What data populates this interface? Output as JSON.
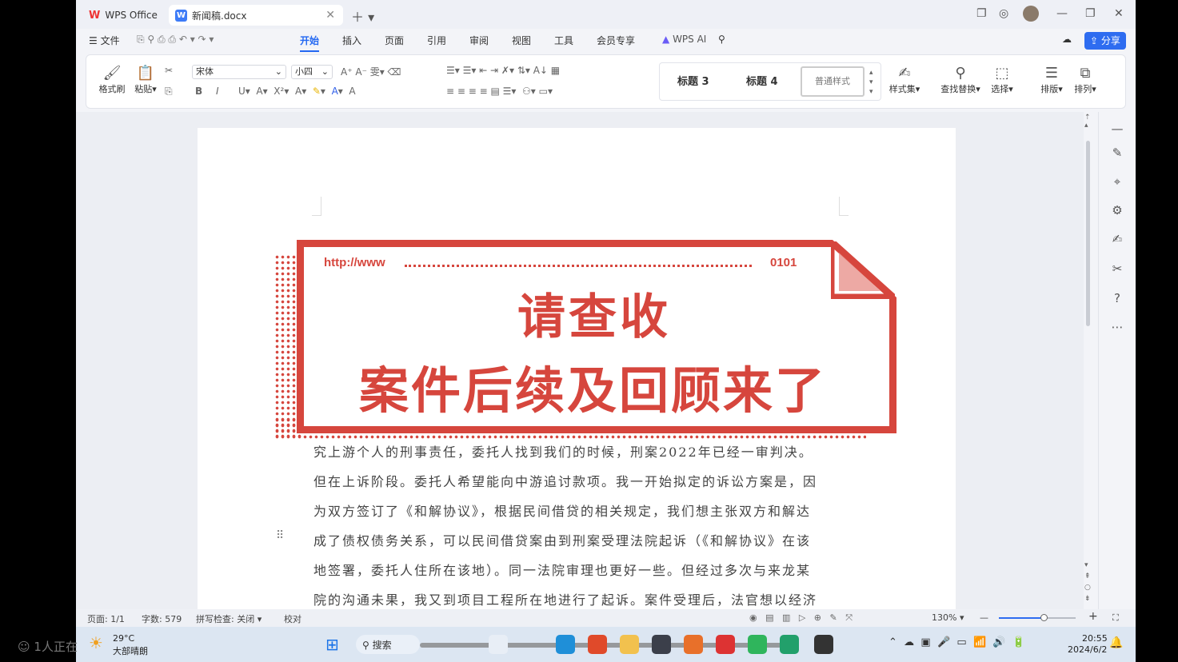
{
  "tabs": [
    {
      "label": "WPS Office"
    },
    {
      "label": "新闻稿.docx"
    }
  ],
  "menu": {
    "file": "文件",
    "items": [
      "开始",
      "插入",
      "页面",
      "引用",
      "审阅",
      "视图",
      "工具",
      "会员专享"
    ],
    "ai": "WPS AI",
    "share": "分享"
  },
  "ribbon": {
    "format_painter": "格式刷",
    "paste": "粘贴",
    "font": "宋体",
    "size": "小四",
    "styles": [
      "标题 3",
      "标题 4",
      "普通样式"
    ],
    "style_set": "样式集",
    "find_replace": "查找替换",
    "select": "选择",
    "layout": "排版",
    "arrange": "排列"
  },
  "banner": {
    "url": "http://www",
    "code": "0101",
    "line1": "请查收",
    "line2": "案件后续及回顾来了"
  },
  "body_lines": [
    "究上游个人的刑事责任，委托人找到我们的时候，刑案2022年已经一审判决。",
    "但在上诉阶段。委托人希望能向中游追讨款项。我一开始拟定的诉讼方案是，因",
    "为双方签订了《和解协议》，根据民间借贷的相关规定，我们想主张双方和解达",
    "成了债权债务关系，可以民间借贷案由到刑案受理法院起诉（《和解协议》在该",
    "地签署，委托人住所在该地）。同一法院审理也更好一些。但经过多次与来龙某",
    "院的沟通未果，我又到项目工程所在地进行了起诉。案件受理后，法官想以经济"
  ],
  "status": {
    "page": "页面: 1/1",
    "words": "字数: 579",
    "spell": "拼写检查: 关闭",
    "proof": "校对",
    "zoom": "130%"
  },
  "taskbar": {
    "search": "搜索",
    "weather_temp": "29°C",
    "weather_desc": "大部晴朗",
    "time": "20:55",
    "date": "2024/6/2"
  },
  "outside": "1人正在"
}
